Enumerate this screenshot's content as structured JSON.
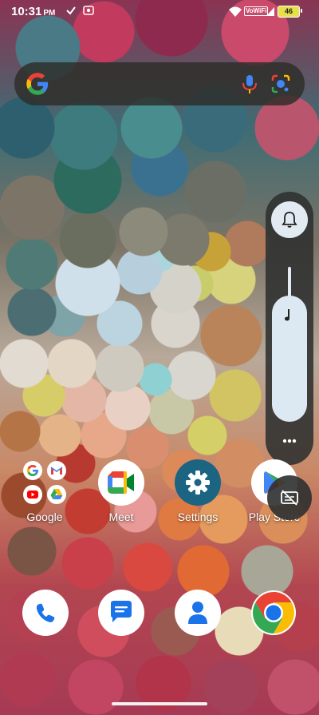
{
  "status_bar": {
    "time": "10:31",
    "ampm": "PM",
    "network_badge": "VoWiFi",
    "battery_level": "46",
    "icons": [
      "check-icon",
      "screen-record-icon",
      "wifi-icon",
      "volte-badge",
      "battery-icon"
    ]
  },
  "search_bar": {
    "icons": [
      "google-g-icon",
      "mic-icon",
      "lens-icon"
    ],
    "colors": {
      "blue": "#4285F4",
      "red": "#EA4335",
      "yellow": "#FBBC05",
      "green": "#34A853"
    }
  },
  "volume_panel": {
    "ringer_mode": "ring",
    "media_volume_level": 0.78,
    "icons": [
      "bell-icon",
      "music-note-icon",
      "more-dots-icon",
      "live-caption-icon"
    ]
  },
  "apps": [
    {
      "label": "Google"
    },
    {
      "label": "Meet"
    },
    {
      "label": "Settings"
    },
    {
      "label": "Play Store"
    }
  ],
  "dock": [
    "phone-icon",
    "messages-icon",
    "contacts-icon",
    "chrome-icon"
  ]
}
